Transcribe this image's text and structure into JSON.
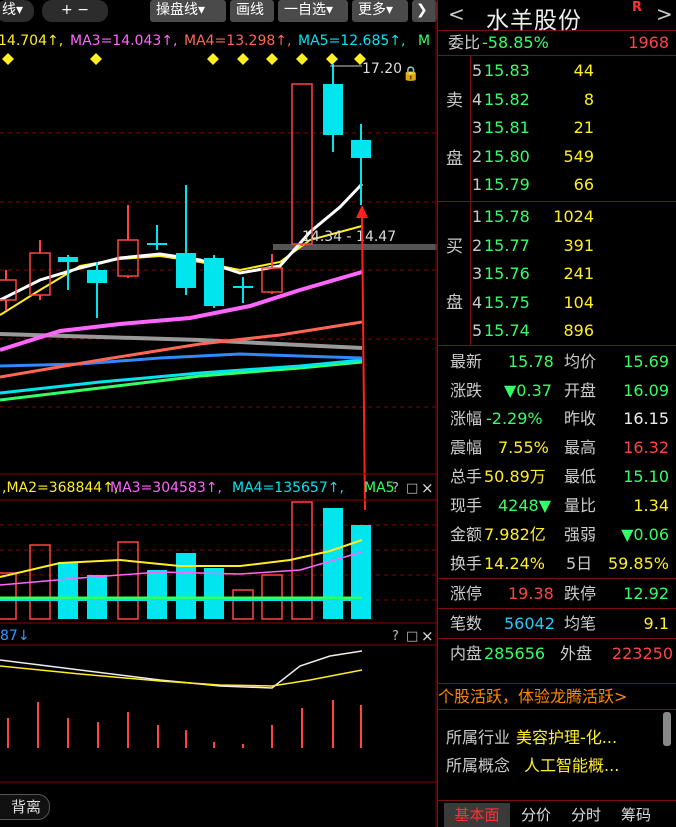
{
  "toolbar": {
    "period_label": "线",
    "zoom_label": "+ −",
    "panel_line_label": "操盘线",
    "draw_label": "画线",
    "watchlist_label": "一自选",
    "more_label": "更多",
    "collapse_label": "❯"
  },
  "ma_legend": {
    "ma2": "14.704↑,",
    "ma3": "MA3=14.043↑,",
    "ma4": "MA4=13.298↑,",
    "ma5": "MA5=12.685↑,",
    "extra": "M"
  },
  "price_chart": {
    "high_label": "17.20",
    "range_label": "14.34 - 14.47"
  },
  "volume_legend": {
    "ma2": ",MA2=368844↑,",
    "ma3": "MA3=304583↑,",
    "ma4": "MA4=135657↑,",
    "ma5": "MA5"
  },
  "macd_legend": {
    "value": "87↓"
  },
  "pane_controls": {
    "lock": "🔒",
    "help": "?",
    "restore": "□",
    "close": "×"
  },
  "bottom_tag": "背离",
  "stock": {
    "name": "水羊股份",
    "badge": "R",
    "prev": "<",
    "next": ">"
  },
  "weibi": {
    "label": "委比",
    "pct": "-58.85%",
    "diff": "1968"
  },
  "asks": {
    "side_chars": [
      "卖",
      "盘"
    ],
    "levels": [
      {
        "n": "5",
        "price": "15.83",
        "vol": "44"
      },
      {
        "n": "4",
        "price": "15.82",
        "vol": "8"
      },
      {
        "n": "3",
        "price": "15.81",
        "vol": "21"
      },
      {
        "n": "2",
        "price": "15.80",
        "vol": "549"
      },
      {
        "n": "1",
        "price": "15.79",
        "vol": "66"
      }
    ]
  },
  "bids": {
    "side_chars": [
      "买",
      "盘"
    ],
    "levels": [
      {
        "n": "1",
        "price": "15.78",
        "vol": "1024"
      },
      {
        "n": "2",
        "price": "15.77",
        "vol": "391"
      },
      {
        "n": "3",
        "price": "15.76",
        "vol": "241"
      },
      {
        "n": "4",
        "price": "15.75",
        "vol": "104"
      },
      {
        "n": "5",
        "price": "15.74",
        "vol": "896"
      }
    ]
  },
  "quote": {
    "latest_label": "最新",
    "latest": "15.78",
    "avg_label": "均价",
    "avg": "15.69",
    "change_label": "涨跌",
    "change": "▼0.37",
    "open_label": "开盘",
    "open": "16.09",
    "pct_label": "涨幅",
    "pct": "-2.29%",
    "prev_close_label": "昨收",
    "prev_close": "16.15",
    "amp_label": "震幅",
    "amp": "7.55%",
    "high_label": "最高",
    "high": "16.32",
    "total_vol_label": "总手",
    "total_vol": "50.89万",
    "low_label": "最低",
    "low": "15.10",
    "cur_vol_label": "现手",
    "cur_vol": "4248▼",
    "vol_ratio_label": "量比",
    "vol_ratio": "1.34",
    "amount_label": "金额",
    "amount": "7.982亿",
    "strength_label": "强弱",
    "strength": "▼0.06",
    "turnover_label": "换手",
    "turnover": "14.24%",
    "five_day_label": "5日",
    "five_day": "59.85%",
    "limit_up_label": "涨停",
    "limit_up": "19.38",
    "limit_down_label": "跌停",
    "limit_down": "12.92",
    "trades_label": "笔数",
    "trades": "56042",
    "per_trade_label": "均笔",
    "per_trade": "9.1",
    "inner_label": "内盘",
    "inner": "285656",
    "outer_label": "外盘",
    "outer": "223250"
  },
  "promo": "个股活跃，体验龙腾活跃>",
  "info": {
    "industry_label": "所属行业",
    "industry": "美容护理-化...",
    "concept_label": "所属概念",
    "concept": "人工智能概..."
  },
  "tabs": [
    "基本面",
    "分价",
    "分时",
    "筹码"
  ],
  "colors": {
    "up": "#ff4444",
    "down": "#00e5ee",
    "ma_white": "#ffffff",
    "ma_yellow": "#ffee22",
    "ma_magenta": "#ff66ff",
    "ma_salmon": "#ff6655",
    "ma_gray": "#999999",
    "ma_green": "#33ff66",
    "ma_blue": "#3388ff",
    "ma_cyan": "#00e5ee",
    "grid": "#8b0000"
  }
}
